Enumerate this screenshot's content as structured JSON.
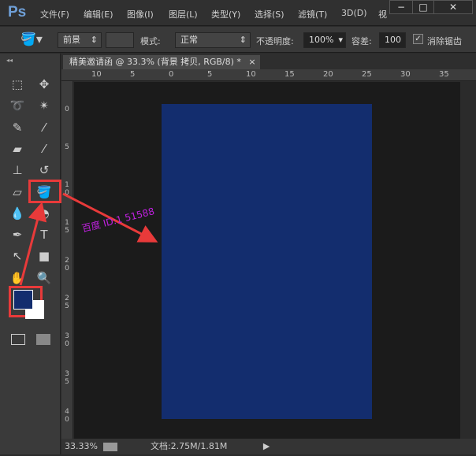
{
  "app": {
    "logo": "Ps"
  },
  "menu": [
    "文件(F)",
    "编辑(E)",
    "图像(I)",
    "图层(L)",
    "类型(Y)",
    "选择(S)",
    "滤镜(T)",
    "3D(D)",
    "视"
  ],
  "window_controls": {
    "minimize": "−",
    "maximize": "□",
    "close": "✕"
  },
  "options": {
    "fill_source": "前景",
    "mode_label": "模式:",
    "mode_value": "正常",
    "opacity_label": "不透明度:",
    "opacity_value": "100%",
    "tolerance_label": "容差:",
    "tolerance_value": "100",
    "antialias_label": "消除锯齿",
    "antialias_checked": true
  },
  "document_tab": {
    "title": "精美邀请函 @ 33.3% (背景 拷贝, RGB/8) *",
    "close": "×"
  },
  "ruler_top": [
    "10",
    "5",
    "0",
    "5",
    "10",
    "15",
    "20",
    "25",
    "30",
    "35"
  ],
  "ruler_left": [
    "0",
    "5",
    "10",
    "15",
    "20",
    "25",
    "30",
    "35",
    "40"
  ],
  "colors": {
    "foreground": "#132d6e",
    "background": "#ffffff",
    "document_fill": "#132d6e",
    "annotation": "#e83a3a"
  },
  "tools": [
    "rect-marquee",
    "move",
    "lasso",
    "magic-wand",
    "crop",
    "eyedropper",
    "healing-brush",
    "brush",
    "clone-stamp",
    "history-brush",
    "eraser",
    "paint-bucket",
    "blur",
    "dodge",
    "pen",
    "type",
    "path-select",
    "rectangle",
    "hand",
    "zoom"
  ],
  "watermark": "百度 ID:1   51588",
  "status": {
    "zoom": "33.33%",
    "doc_info": "文档:2.75M/1.81M",
    "arrow": "▶"
  }
}
